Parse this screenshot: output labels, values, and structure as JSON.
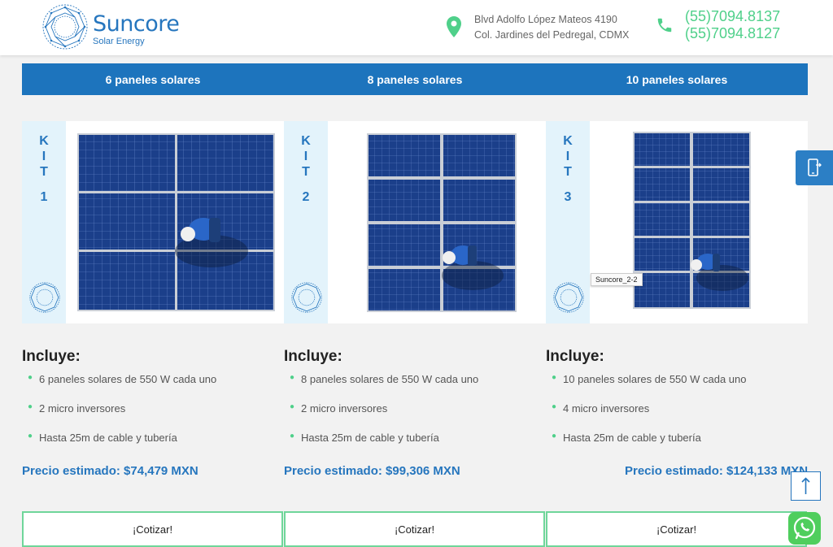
{
  "brand": {
    "name": "Suncore",
    "tagline": "Solar Energy"
  },
  "contact": {
    "address_line1": "Blvd Adolfo López Mateos 4190",
    "address_line2": "Col. Jardines del Pedregal, CDMX",
    "phone1": "(55)7094.8137",
    "phone2": "(55)7094.8127"
  },
  "tabs": [
    {
      "label": "6 paneles solares"
    },
    {
      "label": "8 paneles solares"
    },
    {
      "label": "10 paneles solares"
    }
  ],
  "kits": [
    {
      "k": "K",
      "i": "I",
      "t": "T",
      "num": "1",
      "includes_title": "Incluye:",
      "items": [
        "6 paneles solares de 550 W cada uno",
        "2 micro inversores",
        "Hasta 25m de cable y tubería"
      ],
      "price": "Precio estimado: $74,479 MXN",
      "cta": "¡Cotizar!"
    },
    {
      "k": "K",
      "i": "I",
      "t": "T",
      "num": "2",
      "includes_title": "Incluye:",
      "items": [
        "8 paneles solares de 550 W cada uno",
        "2 micro inversores",
        "Hasta 25m de cable y tubería"
      ],
      "price": "Precio estimado: $99,306 MXN",
      "cta": "¡Cotizar!"
    },
    {
      "k": "K",
      "i": "I",
      "t": "T",
      "num": "3",
      "includes_title": "Incluye:",
      "items": [
        "10 paneles solares de 550 W cada uno",
        "4 micro inversores",
        "Hasta 25m de cable y tubería"
      ],
      "price": "Precio estimado: $124,133 MXN",
      "cta": "¡Cotizar!"
    }
  ],
  "tooltip": "Suncore_2-2",
  "icons": {
    "location": "map-pin-icon",
    "phone": "phone-icon",
    "mobile": "mobile-phone-icon",
    "scroll_top": "arrow-up-icon",
    "whatsapp": "whatsapp-icon"
  },
  "colors": {
    "brand_blue": "#2676be",
    "tab_bar": "#1d74bd",
    "accent_green": "#4fd08a",
    "whatsapp_green": "#4fce5d"
  }
}
